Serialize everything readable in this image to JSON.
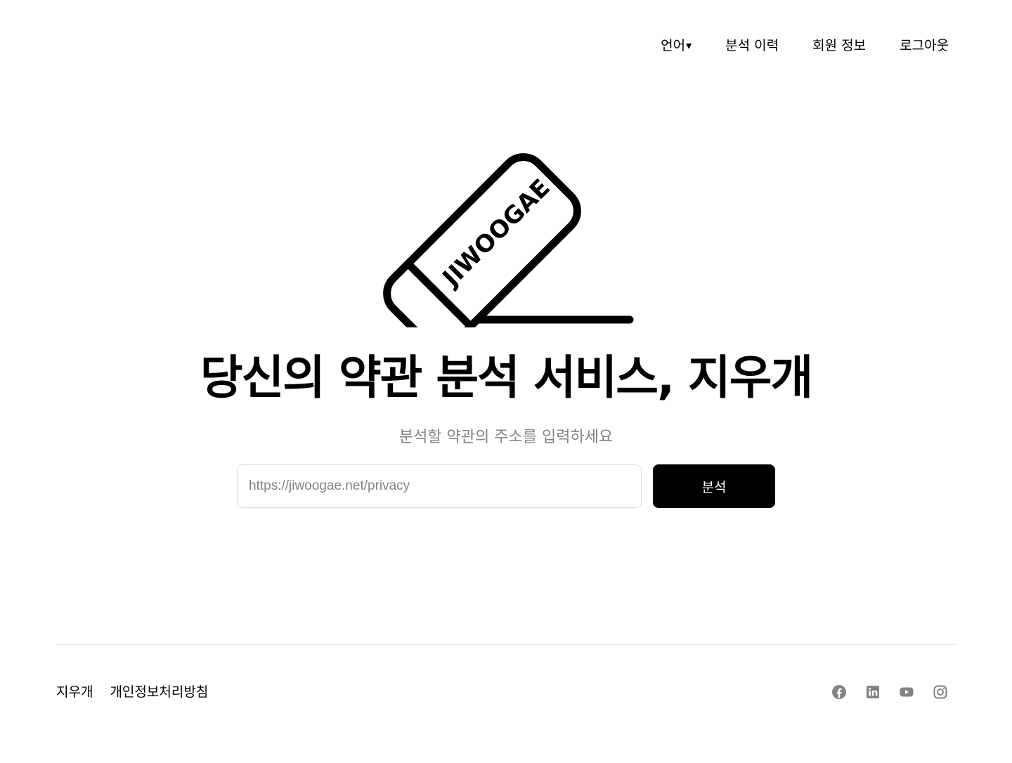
{
  "nav": {
    "language_label": "언어",
    "language_caret": "▾",
    "history": "분석 이력",
    "profile": "회원 정보",
    "logout": "로그아웃"
  },
  "logo": {
    "text": "JIWOOGAE"
  },
  "hero": {
    "title": "당신의 약관 분석 서비스, 지우개",
    "subtitle": "분석할 약관의 주소를 입력하세요"
  },
  "form": {
    "url_placeholder": "https://jiwoogae.net/privacy",
    "url_value": "",
    "submit_label": "분석"
  },
  "footer": {
    "brand": "지우개",
    "privacy_policy": "개인정보처리방침",
    "social_icons": [
      "facebook-icon",
      "linkedin-icon",
      "youtube-icon",
      "instagram-icon"
    ],
    "icon_color": "#828282"
  },
  "colors": {
    "primary": "#000000",
    "muted_text": "#828282",
    "divider": "#e6e6e6",
    "background": "#ffffff"
  }
}
